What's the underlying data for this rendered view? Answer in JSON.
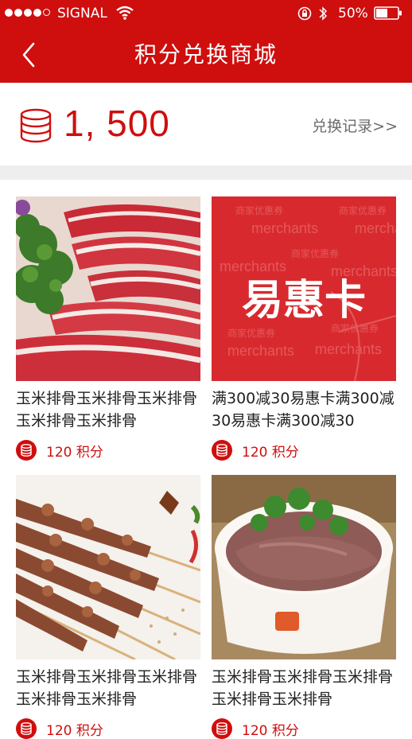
{
  "status_bar": {
    "carrier": "SIGNAL",
    "battery": "50%"
  },
  "nav": {
    "title": "积分兑换商城"
  },
  "points": {
    "value": "1, 500",
    "record_link": "兑换记录>>"
  },
  "products": [
    {
      "title": "玉米排骨玉米排骨玉米排骨玉米排骨玉米排骨",
      "price": "120 积分",
      "image": "sliced-lamb-meat"
    },
    {
      "title": "满300减30易惠卡满300减30易惠卡满300减30",
      "price": "120 积分",
      "image": "coupon-card",
      "card_text": "易惠卡",
      "watermark_cn": "商家优惠券",
      "watermark_en": "merchants"
    },
    {
      "title": "玉米排骨玉米排骨玉米排骨玉米排骨玉米排骨",
      "price": "120 积分",
      "image": "lamb-skewers"
    },
    {
      "title": "玉米排骨玉米排骨玉米排骨玉米排骨玉米排骨",
      "price": "120 积分",
      "image": "beef-bowl"
    }
  ],
  "colors": {
    "brand_red": "#cf0e0e",
    "divider": "#eeeeee"
  }
}
